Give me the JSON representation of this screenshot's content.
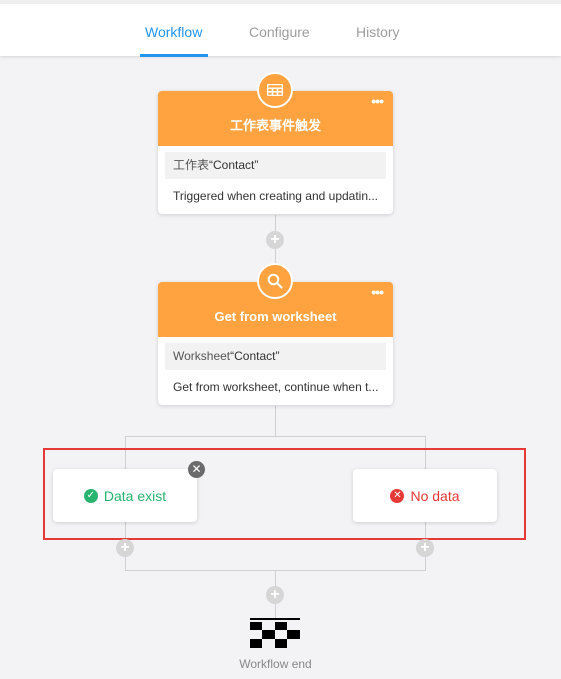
{
  "tabs": [
    {
      "label": "Workflow",
      "active": true
    },
    {
      "label": "Configure",
      "active": false
    },
    {
      "label": "History",
      "active": false
    }
  ],
  "nodes": {
    "trigger": {
      "title": "工作表事件触发",
      "more": "•••",
      "icon": "table-icon",
      "sub_prefix": "工作表",
      "sub_value": "“Contact”",
      "desc": "Triggered when creating and updatin..."
    },
    "get": {
      "title": "Get from worksheet",
      "more": "•••",
      "icon": "search-icon",
      "sub_prefix": "Worksheet",
      "sub_value": "“Contact”",
      "desc": "Get from worksheet, continue when t..."
    }
  },
  "branches": {
    "exist": {
      "label": "Data exist",
      "icon": "check-circle-icon",
      "color": "#27b46e"
    },
    "none": {
      "label": "No data",
      "icon": "x-circle-icon",
      "color": "#e53935"
    }
  },
  "plus_symbol": "+",
  "close_symbol": "✕",
  "end_label": "Workflow end",
  "colors": {
    "accent": "#2196f3",
    "node_header": "#ffa340",
    "highlight_frame": "#e53935"
  }
}
